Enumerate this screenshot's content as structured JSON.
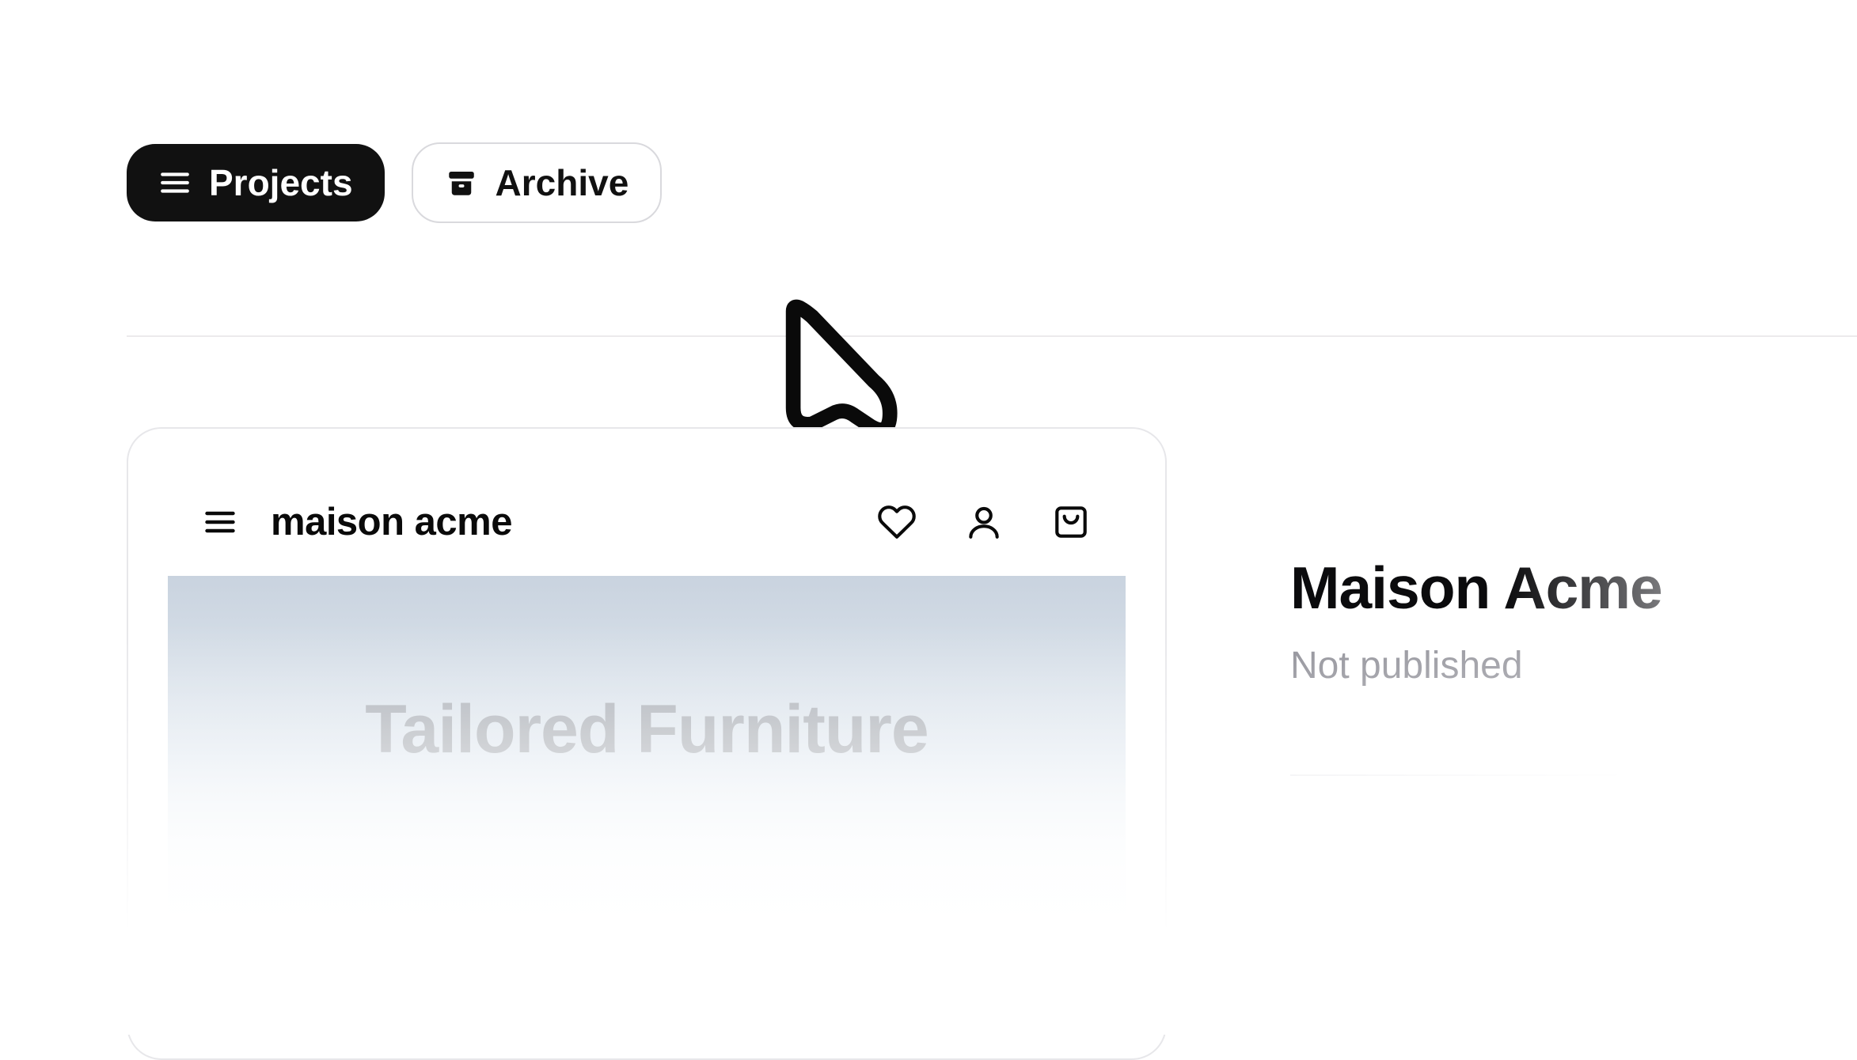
{
  "tabs": {
    "projects": {
      "label": "Projects"
    },
    "archive": {
      "label": "Archive"
    }
  },
  "project": {
    "title": "Maison Acme",
    "status": "Not published"
  },
  "preview": {
    "brand": "maison acme",
    "hero_text": "Tailored Furniture"
  }
}
